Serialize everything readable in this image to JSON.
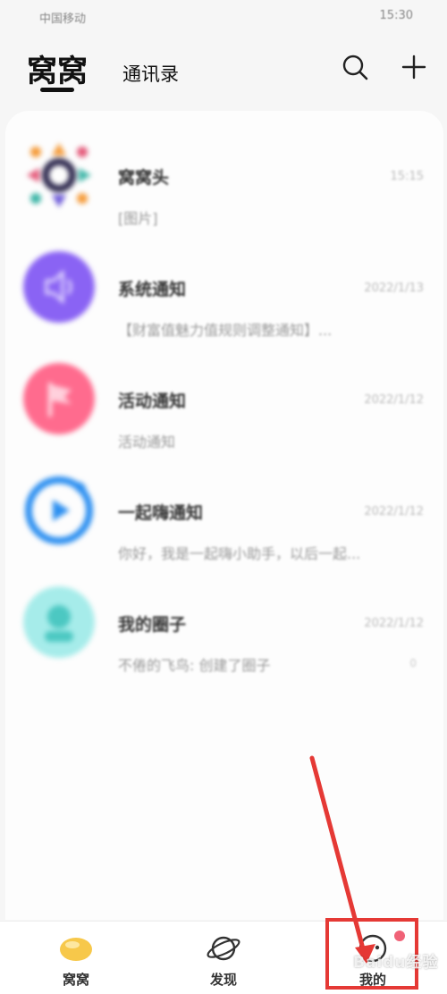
{
  "status_bar": {
    "carrier": "中国移动",
    "time": "15:30"
  },
  "header": {
    "active_tab": "窝窝",
    "contacts_tab": "通讯录",
    "search_icon": "search-icon",
    "add_icon": "plus-icon"
  },
  "conversations": [
    {
      "name": "窝窝头",
      "time": "15:15",
      "preview": "[图片]",
      "avatar_colors": [
        "#2f2a4f",
        "#f59c3b",
        "#3fb6a8",
        "#e45a7a",
        "#6e5bd8"
      ]
    },
    {
      "name": "系统通知",
      "time": "2022/1/13",
      "preview": "【财富值魅力值规则调整通知】...",
      "avatar_colors": [
        "#8a63f4",
        "#b89cff"
      ]
    },
    {
      "name": "活动通知",
      "time": "2022/1/12",
      "preview": "活动通知",
      "avatar_colors": [
        "#ff6b8e",
        "#ff9db2"
      ]
    },
    {
      "name": "一起嗨通知",
      "time": "2022/1/12",
      "preview": "你好，我是一起嗨小助手，以后一起...",
      "avatar_colors": [
        "#2c8ff0",
        "#ffffff"
      ]
    },
    {
      "name": "我的圈子",
      "time": "2022/1/12",
      "preview": "不倦的飞鸟: 创建了圈子",
      "unread": "0",
      "avatar_colors": [
        "#a6ecea",
        "#4cc8c2"
      ]
    }
  ],
  "bottom_nav": {
    "home": "窝窝",
    "discover": "发现",
    "mine": "我的"
  },
  "colors": {
    "annotation_red": "#e53935",
    "badge_pink": "#f06277"
  },
  "watermark": "Baidu经验"
}
